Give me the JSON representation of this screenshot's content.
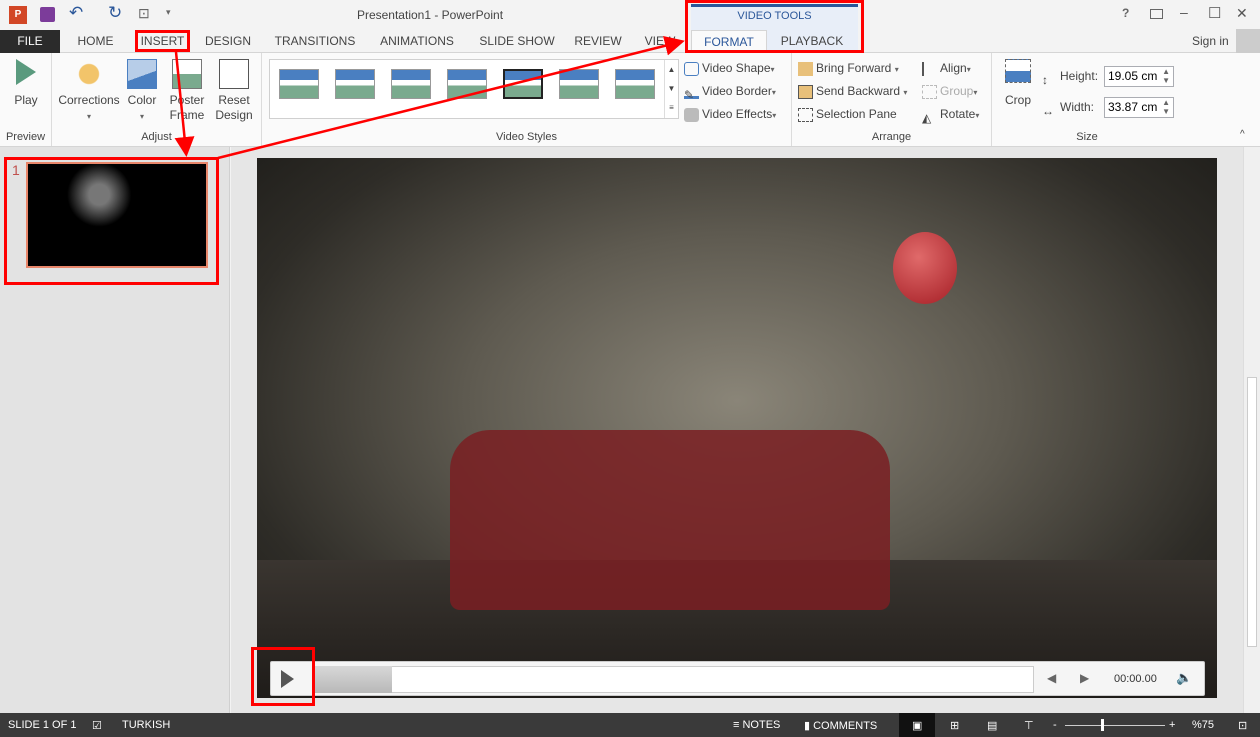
{
  "titlebar": {
    "title": "Presentation1 - PowerPoint",
    "sign_in": "Sign in",
    "help": "?",
    "minimize": "–",
    "restore": "☐",
    "close": "✕"
  },
  "tabs": {
    "file": "FILE",
    "items": [
      "HOME",
      "INSERT",
      "DESIGN",
      "TRANSITIONS",
      "ANIMATIONS",
      "SLIDE SHOW",
      "REVIEW",
      "VIEW"
    ],
    "context_group": "VIDEO TOOLS",
    "format": "FORMAT",
    "playback": "PLAYBACK"
  },
  "ribbon": {
    "preview": {
      "label": "Preview",
      "play": "Play"
    },
    "adjust": {
      "label": "Adjust",
      "corrections": "Corrections",
      "color": "Color",
      "poster_frame": "Poster Frame",
      "reset_design": "Reset Design"
    },
    "video_styles": {
      "label": "Video Styles",
      "video_shape": "Video Shape",
      "video_border": "Video Border",
      "video_effects": "Video Effects"
    },
    "arrange": {
      "label": "Arrange",
      "bring_forward": "Bring Forward",
      "send_backward": "Send Backward",
      "selection_pane": "Selection Pane",
      "align": "Align",
      "group": "Group",
      "rotate": "Rotate"
    },
    "size": {
      "label": "Size",
      "crop": "Crop",
      "height_label": "Height:",
      "height_value": "19.05 cm",
      "width_label": "Width:",
      "width_value": "33.87 cm"
    }
  },
  "slides": {
    "number": "1"
  },
  "player": {
    "time": "00:00.00",
    "progress_percent": 0
  },
  "status": {
    "slide": "SLIDE 1 OF 1",
    "language": "TURKISH",
    "notes": "NOTES",
    "comments": "COMMENTS",
    "zoom": "%75"
  },
  "colors": {
    "accent": "#2b579a",
    "annotation": "#ff0000",
    "file_tab": "#2b2b2b"
  }
}
